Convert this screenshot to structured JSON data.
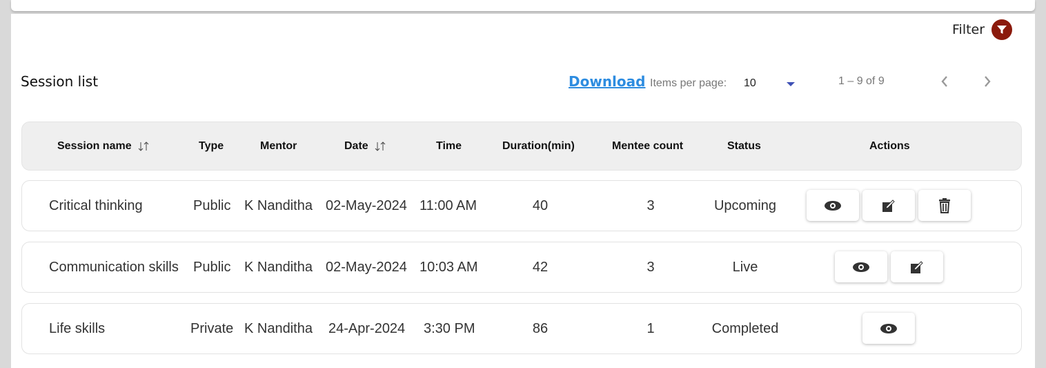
{
  "toolbar": {
    "filter_label": "Filter",
    "filter_icon": "filter-icon"
  },
  "list": {
    "title": "Session list",
    "download_label": "Download",
    "items_per_page_label": "Items per page:",
    "items_per_page_value": "10",
    "range_label": "1 – 9 of 9"
  },
  "columns": {
    "session_name": "Session name",
    "type": "Type",
    "mentor": "Mentor",
    "date": "Date",
    "time": "Time",
    "duration": "Duration(min)",
    "mentee_count": "Mentee count",
    "status": "Status",
    "actions": "Actions"
  },
  "rows": [
    {
      "session_name": "Critical thinking",
      "type": "Public",
      "mentor": "K Nanditha",
      "date": "02-May-2024",
      "time": "11:00 AM",
      "duration": "40",
      "mentee_count": "3",
      "status": "Upcoming",
      "actions": [
        "view-icon",
        "edit-icon",
        "delete-icon"
      ]
    },
    {
      "session_name": "Communication skills",
      "type": "Public",
      "mentor": "K Nanditha",
      "date": "02-May-2024",
      "time": "10:03 AM",
      "duration": "42",
      "mentee_count": "3",
      "status": "Live",
      "actions": [
        "view-icon",
        "edit-icon"
      ]
    },
    {
      "session_name": "Life skills",
      "type": "Private",
      "mentor": "K Nanditha",
      "date": "24-Apr-2024",
      "time": "3:30 PM",
      "duration": "86",
      "mentee_count": "1",
      "status": "Completed",
      "actions": [
        "view-icon"
      ]
    }
  ],
  "colors": {
    "filter_accent": "#8b1a0c",
    "download_link": "#2d8ce0",
    "dropdown_arrow": "#3f51b5"
  }
}
